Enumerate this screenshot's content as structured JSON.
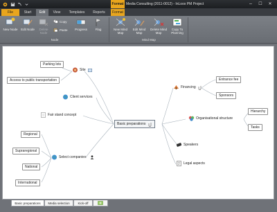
{
  "window": {
    "context_tab": "Format",
    "title": "Media Consulting (2011-0012) - InLoox PM Project",
    "min": "–",
    "max": "☐",
    "close": "✕"
  },
  "tabs": {
    "file": "File",
    "start": "Start",
    "edit": "Edit",
    "view": "View",
    "templates": "Templates",
    "reports": "Reports",
    "format": "Format"
  },
  "ribbon": {
    "new_node": "New Node",
    "edit_node": "Edit Node",
    "delete_node": "Delete Node",
    "copy": "Copy",
    "paste": "Paste",
    "progress": "Progress",
    "flag": "Flag",
    "group_node": "Node",
    "new_mind_map": "New Mind Map",
    "edit_mind_map": "Edit Mind Map",
    "delete_mind_map": "Delete Mind Map",
    "copy_to_planning": "Copy To Planning",
    "group_mind_map": "Mind Map"
  },
  "mindmap": {
    "center": "Basic preparations",
    "site": "Site",
    "parking": "Parking lots",
    "access": "Access to public transportation",
    "client_services": "Client services",
    "fair_stand": "Fair stand concept",
    "select_companies": "Select companies",
    "regional": "Regional",
    "supraregional": "Supraregional",
    "national": "National",
    "international": "International",
    "financing": "Financing",
    "entrance_fee": "Entrance fee",
    "sponsors": "Sponsors",
    "org_structure": "Organisational structure",
    "hierarchy": "Hierarchy",
    "tasks": "Tasks",
    "speakers": "Speakers",
    "legal": "Legal aspects"
  },
  "bottom_tabs": {
    "t1": "Basic preparations",
    "t2": "Media selection",
    "t3": "Kick-off"
  },
  "colors": {
    "accent": "#e9a51d",
    "ribbon": "#6d7177"
  }
}
